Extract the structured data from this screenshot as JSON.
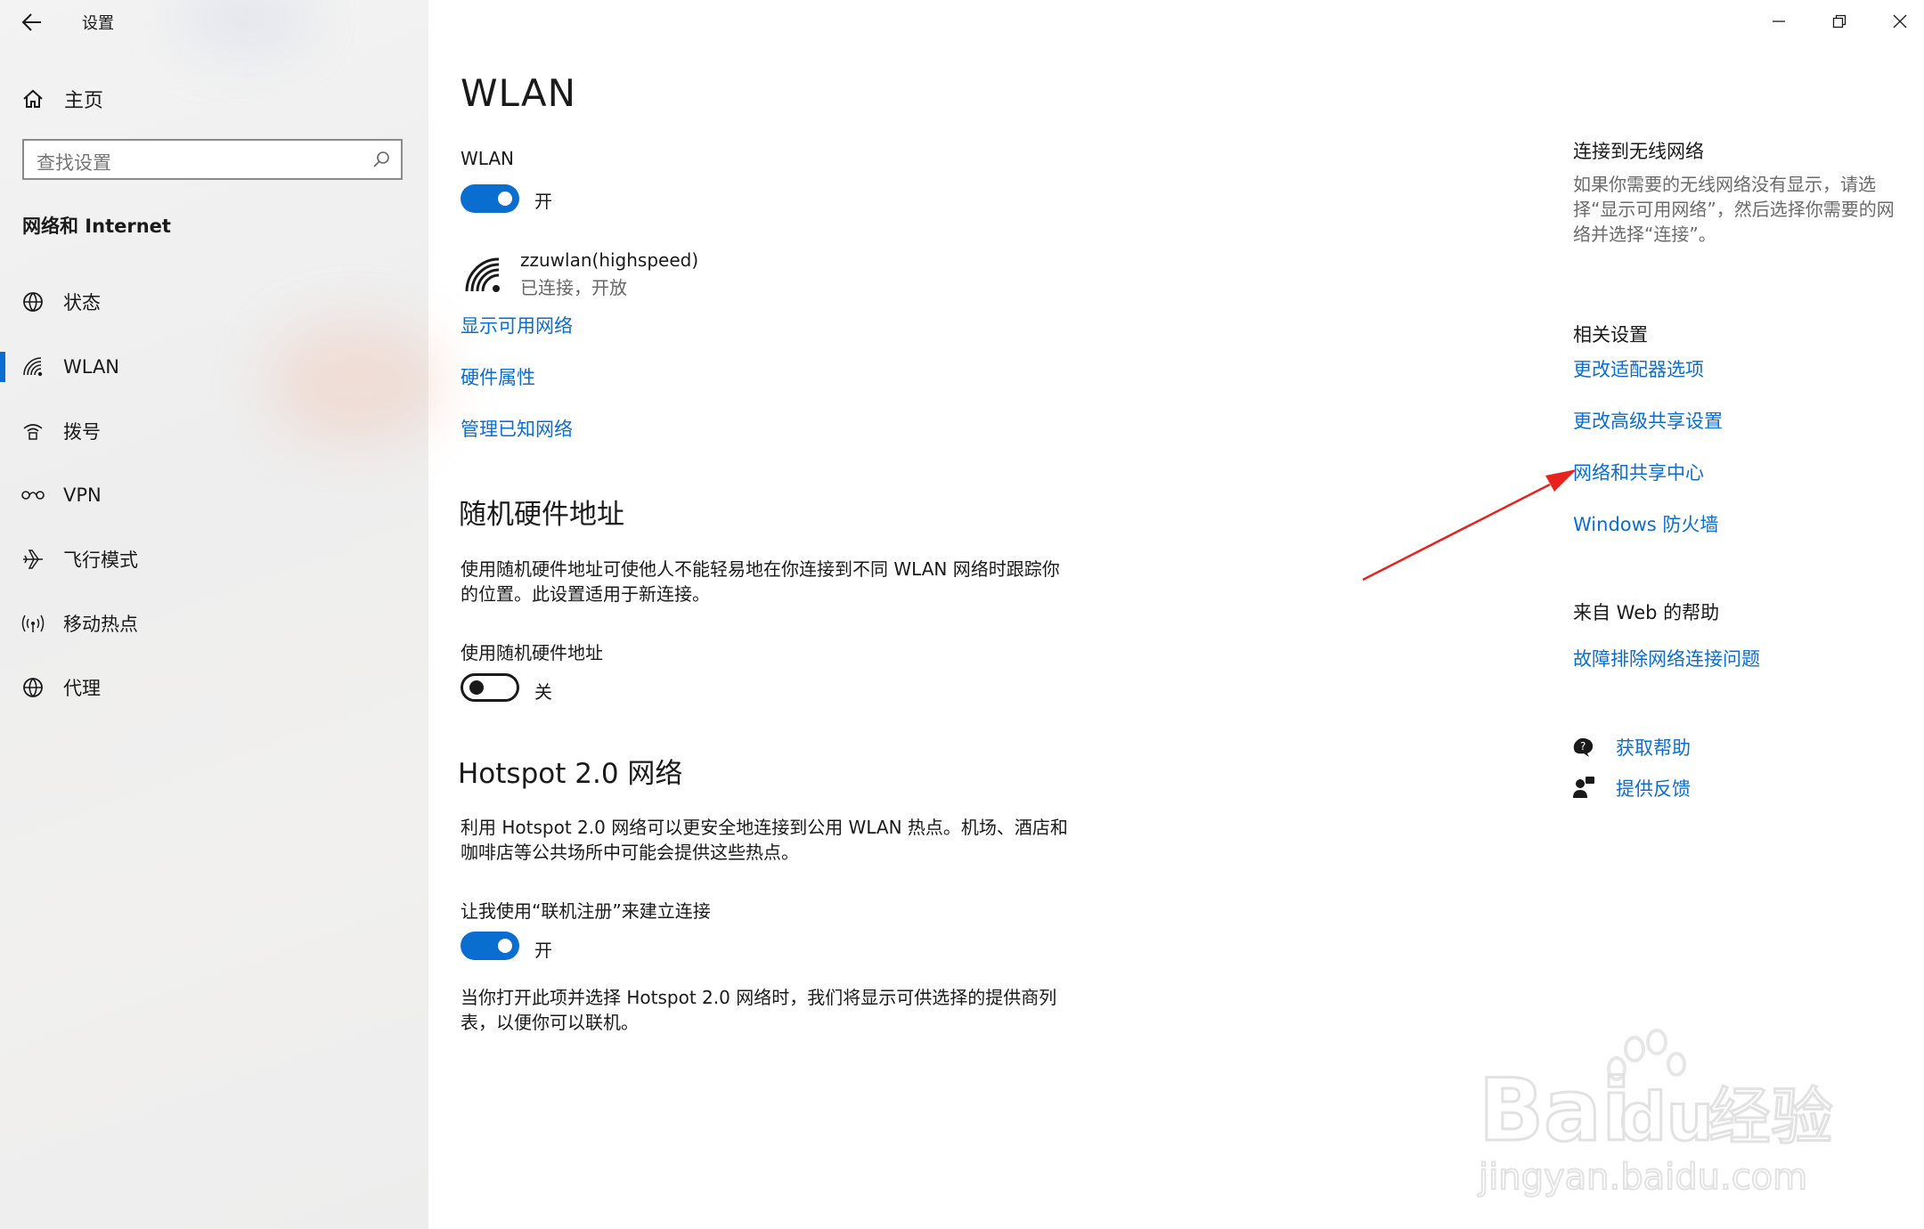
{
  "window": {
    "title": "设置",
    "controls": [
      "minimize-icon",
      "restore-icon",
      "close-icon"
    ]
  },
  "sidebar": {
    "home_label": "主页",
    "search_placeholder": "查找设置",
    "section": "网络和 Internet",
    "items": [
      {
        "label": "状态",
        "icon": "globe-status-icon",
        "selected": false
      },
      {
        "label": "WLAN",
        "icon": "wifi-icon",
        "selected": true
      },
      {
        "label": "拨号",
        "icon": "dialup-icon",
        "selected": false
      },
      {
        "label": "VPN",
        "icon": "vpn-icon",
        "selected": false
      },
      {
        "label": "飞行模式",
        "icon": "airplane-icon",
        "selected": false
      },
      {
        "label": "移动热点",
        "icon": "hotspot-icon",
        "selected": false
      },
      {
        "label": "代理",
        "icon": "globe-icon",
        "selected": false
      }
    ]
  },
  "main": {
    "title": "WLAN",
    "wlan_label": "WLAN",
    "wlan_toggle": {
      "state": "开",
      "on": true
    },
    "network": {
      "name": "zzuwlan(highspeed)",
      "status": "已连接，开放"
    },
    "links": [
      "显示可用网络",
      "硬件属性",
      "管理已知网络"
    ],
    "random_hw": {
      "heading": "随机硬件地址",
      "desc": "使用随机硬件地址可使他人不能轻易地在你连接到不同 WLAN 网络时跟踪你的位置。此设置适用于新连接。",
      "toggle_label": "使用随机硬件地址",
      "toggle": {
        "state": "关",
        "on": false
      }
    },
    "hotspot": {
      "heading": "Hotspot 2.0 网络",
      "desc": "利用 Hotspot 2.0 网络可以更安全地连接到公用 WLAN 热点。机场、酒店和咖啡店等公共场所中可能会提供这些热点。",
      "toggle_label": "让我使用“联机注册”来建立连接",
      "toggle": {
        "state": "开",
        "on": true
      },
      "note": "当你打开此项并选择 Hotspot 2.0 网络时，我们将显示可供选择的提供商列表，以便你可以联机。"
    }
  },
  "right": {
    "connect_heading": "连接到无线网络",
    "connect_desc": "如果你需要的无线网络没有显示，请选择“显示可用网络”，然后选择你需要的网络并选择“连接”。",
    "related_heading": "相关设置",
    "related_links": [
      "更改适配器选项",
      "更改高级共享设置",
      "网络和共享中心",
      "Windows 防火墙"
    ],
    "web_help_heading": "来自 Web 的帮助",
    "web_help_link": "故障排除网络连接问题",
    "get_help": "获取帮助",
    "feedback": "提供反馈"
  },
  "accent_color": "#0a6ed1",
  "annotation_color": "#e8231f",
  "watermark": {
    "logo": "Baidu经验",
    "url": "jingyan.baidu.com"
  }
}
